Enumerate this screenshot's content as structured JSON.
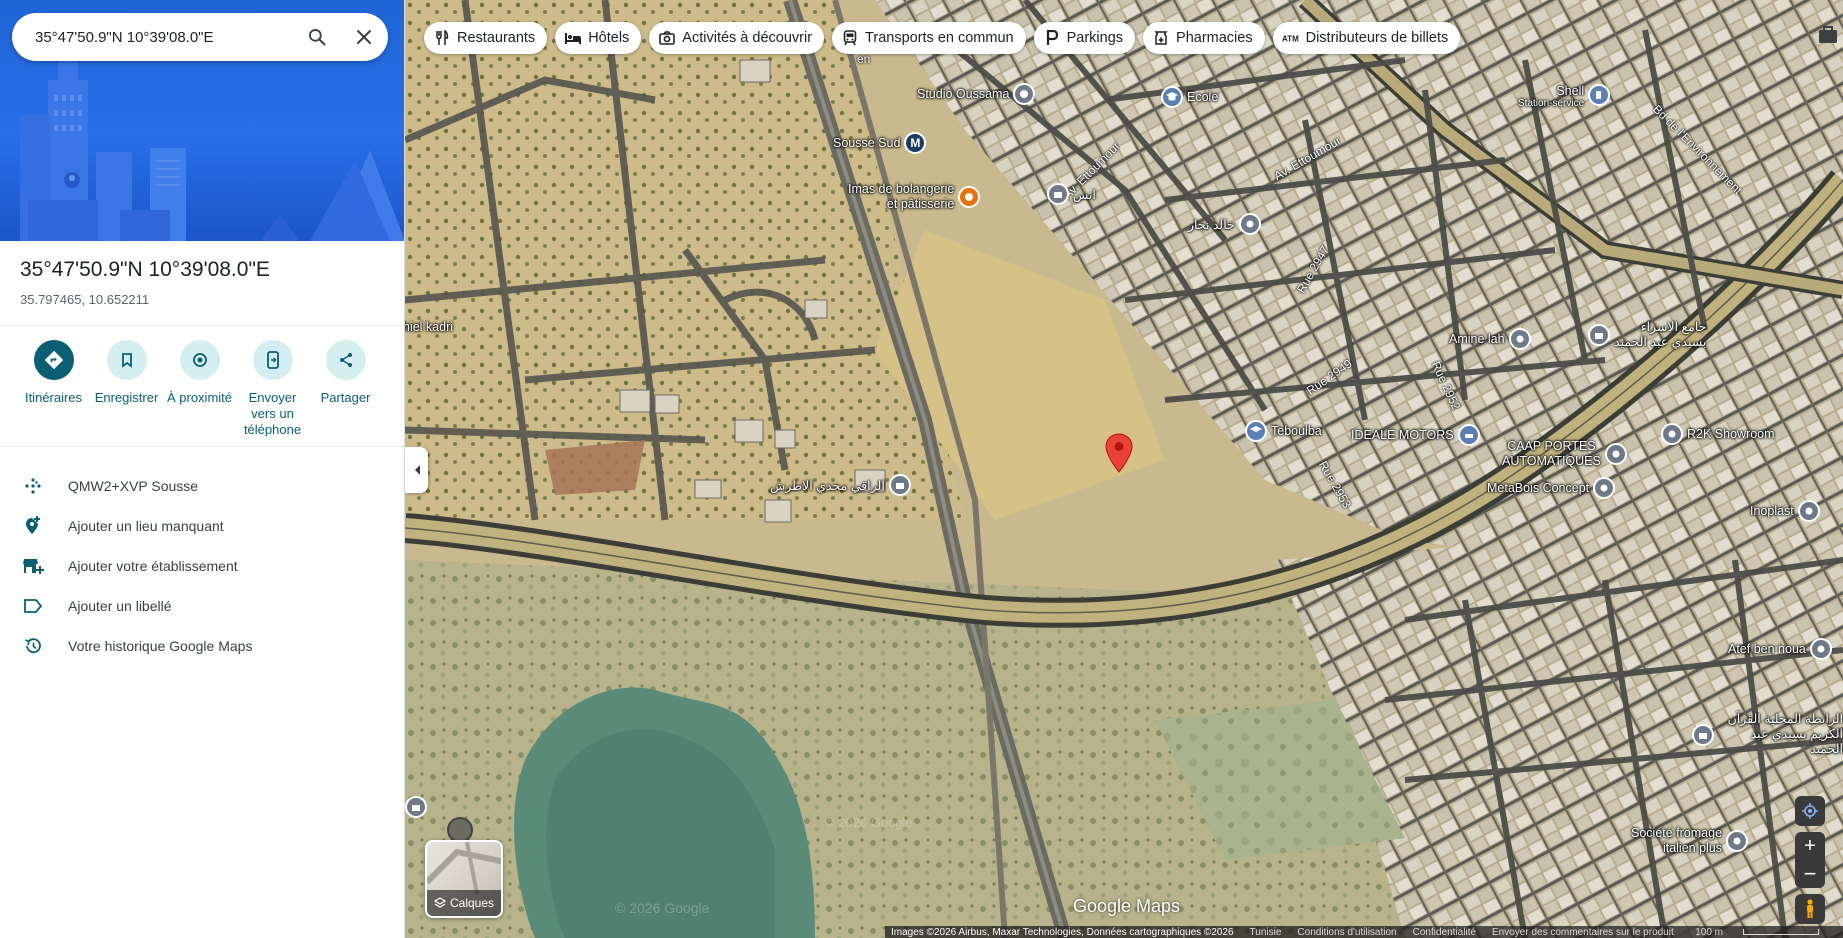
{
  "search": {
    "value": "35°47'50.9\"N 10°39'08.0\"E"
  },
  "place": {
    "title": "35°47'50.9\"N 10°39'08.0\"E",
    "decimal": "35.797465, 10.652211"
  },
  "actions": [
    {
      "label": "Itinéraires",
      "icon": "directions-icon"
    },
    {
      "label": "Enregistrer",
      "icon": "bookmark-icon"
    },
    {
      "label": "À proximité",
      "icon": "nearby-icon"
    },
    {
      "label": "Envoyer vers un téléphone",
      "icon": "send-to-phone-icon"
    },
    {
      "label": "Partager",
      "icon": "share-icon"
    }
  ],
  "menu": [
    {
      "label": "QMW2+XVP Sousse",
      "icon": "plus-code-icon"
    },
    {
      "label": "Ajouter un lieu manquant",
      "icon": "add-location-icon"
    },
    {
      "label": "Ajouter votre établissement",
      "icon": "add-business-icon"
    },
    {
      "label": "Ajouter un libellé",
      "icon": "label-icon"
    },
    {
      "label": "Votre historique Google Maps",
      "icon": "history-icon"
    }
  ],
  "chips": [
    {
      "label": "Restaurants",
      "icon": "restaurant-icon"
    },
    {
      "label": "Hôtels",
      "icon": "hotel-icon"
    },
    {
      "label": "Activités à découvrir",
      "icon": "camera-icon"
    },
    {
      "label": "Transports en commun",
      "icon": "transit-icon"
    },
    {
      "label": "Parkings",
      "icon": "parking-icon"
    },
    {
      "label": "Pharmacies",
      "icon": "pharmacy-icon"
    },
    {
      "label": "Distributeurs de billets",
      "icon": "atm-icon"
    }
  ],
  "pois": {
    "studio": "Studio Oussama",
    "ecole": "Ecole",
    "metro": "Sousse Sud",
    "bakery": "Imas de bolangerie\net pâtisserie",
    "anas": "انس",
    "khaled": "خالد نجار",
    "shell": "Shell",
    "shell_sub": "Station-service",
    "mosque": "جامع الاسراء\nبسيدي عبد الحميد",
    "amine": "Amine lah",
    "teboulba": "Teboulba",
    "ideale": "IDEALE MOTORS",
    "caap": "CAAP PORTES\nAUTOMATIQUES",
    "metabois": "MetaBois Concept",
    "r2k": "R2K Showroom",
    "inoplast": "Inoplast",
    "raqi": "الراقي مجدي الاطرش",
    "kadri": "hiel kadri",
    "atef": "Atef ben noua",
    "rabita": "الرابطة المحلية القرآن\nالكريم بسيدي عبد الحميد",
    "fromage": "Société fromage\nitalien plus"
  },
  "roads": {
    "ettoumour1": "Av. Ettoumour",
    "ettoumour2": "Av. Ettoumour",
    "rue2947": "Rue 2947",
    "rue2949": "Rue 2949",
    "rue2952": "Rue 2952",
    "rue2953": "Rue 2953",
    "bd": "Bd de l'Environnement",
    "frag": "en"
  },
  "layers_label": "Calques",
  "logo": "Google Maps",
  "watermark": "© 2026 Google",
  "watermark2": "© 2026 Google",
  "attribution": {
    "imagery": "Images ©2026 Airbus, Maxar Technologies, Données cartographiques ©2026",
    "country": "Tunisie",
    "terms": "Conditions d'utilisation",
    "privacy": "Confidentialité",
    "feedback": "Envoyer des commentaires sur le produit",
    "scale": "100 m"
  },
  "colors": {
    "accent": "#0b5f75",
    "pin": "#ea4335",
    "poi_blue": "#5b7fb3",
    "poi_orange": "#e8710a",
    "poi_gray": "#6f7a89"
  }
}
